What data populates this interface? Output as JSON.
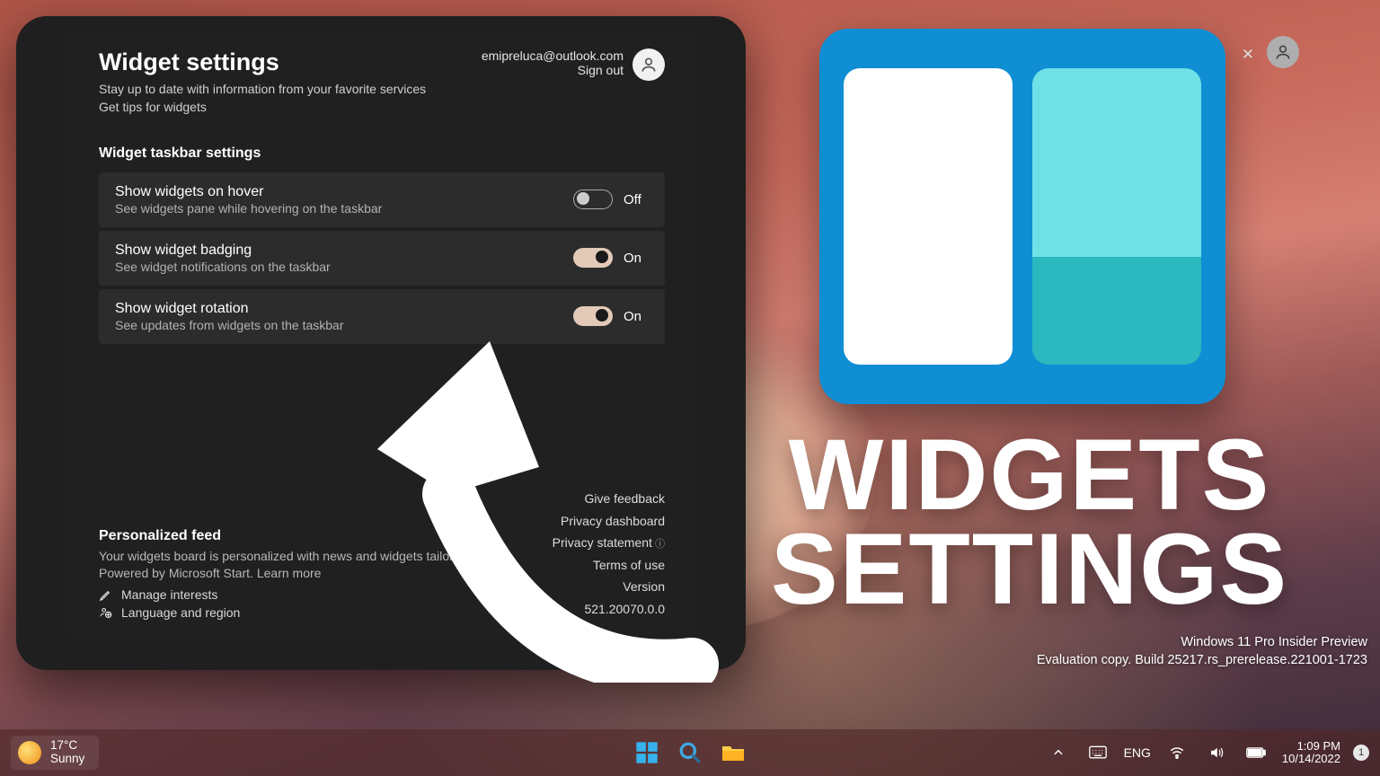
{
  "header": {
    "title": "Widget settings",
    "subtitle1": "Stay up to date with information from your favorite services",
    "subtitle2": "Get tips for widgets",
    "email": "emipreluca@outlook.com",
    "signout": "Sign out"
  },
  "section": {
    "taskbar": "Widget taskbar settings"
  },
  "settings": [
    {
      "title": "Show widgets on hover",
      "desc": "See widgets pane while hovering on the taskbar",
      "state_label": "Off",
      "on": false
    },
    {
      "title": "Show widget badging",
      "desc": "See widget notifications on the taskbar",
      "state_label": "On",
      "on": true
    },
    {
      "title": "Show widget rotation",
      "desc": "See updates from widgets on the taskbar",
      "state_label": "On",
      "on": true
    }
  ],
  "feed": {
    "title": "Personalized feed",
    "desc": "Your widgets board is personalized with news and widgets tailored to you. Powered by Microsoft Start. Learn more",
    "manage": "Manage interests",
    "language": "Language and region"
  },
  "links": {
    "feedback": "Give feedback",
    "privacy_dash": "Privacy dashboard",
    "privacy_stmt": "Privacy statement",
    "terms": "Terms of use",
    "version": "Version",
    "build": "521.20070.0.0"
  },
  "promo": {
    "line1": "WIDGETS",
    "line2": "SETTINGS"
  },
  "watermark": {
    "line1": "Windows 11 Pro Insider Preview",
    "line2": "Evaluation copy. Build 25217.rs_prerelease.221001-1723"
  },
  "taskbar": {
    "temp": "17°C",
    "weather": "Sunny",
    "lang": "ENG",
    "time": "1:09 PM",
    "date": "10/14/2022",
    "noti_count": "1"
  }
}
